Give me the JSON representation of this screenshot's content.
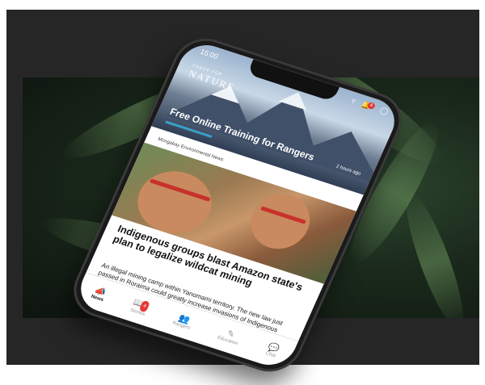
{
  "status": {
    "time": "15:00",
    "notification_count": "4"
  },
  "brand": {
    "top": "FORCE FOR",
    "name": "NATURE"
  },
  "hero": {
    "title": "Free Online Training for Rangers",
    "time": "2 hours ago"
  },
  "article": {
    "source": "Mongabay Environmental News",
    "headline": "Indigenous groups blast Amazon state's plan to legalize wildcat mining",
    "body": "An illegal mining camp within Yanomami territory. The new law just passed in Roraima could greatly increase invasions of Indigenous"
  },
  "tabs": [
    {
      "label": "News",
      "icon": "megaphone-icon",
      "badge": ""
    },
    {
      "label": "Stories",
      "icon": "book-icon",
      "badge": "4"
    },
    {
      "label": "Rangers",
      "icon": "people-icon",
      "badge": ""
    },
    {
      "label": "Education",
      "icon": "pencil-icon",
      "badge": ""
    },
    {
      "label": "Chat",
      "icon": "chat-icon",
      "badge": ""
    }
  ]
}
